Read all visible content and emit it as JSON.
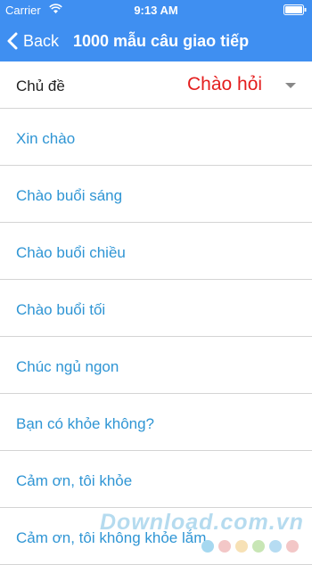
{
  "status_bar": {
    "carrier": "Carrier",
    "time": "9:13 AM",
    "wifi_icon": "wifi-icon",
    "battery_icon": "battery-icon"
  },
  "nav": {
    "back_label": "Back",
    "back_icon": "chevron-left-icon",
    "title": "1000 mẫu câu giao tiếp"
  },
  "topic": {
    "label": "Chủ đề",
    "value": "Chào hỏi",
    "dropdown_icon": "dropdown-arrow-icon"
  },
  "phrases": [
    "Xin chào",
    "Chào buổi sáng",
    "Chào buổi chiều",
    "Chào buổi tối",
    "Chúc ngủ ngon",
    "Bạn có khỏe không?",
    "Cảm ơn, tôi khỏe",
    "Cảm ơn, tôi không khỏe lắm."
  ],
  "watermark": {
    "text": "Download.com.vn",
    "dot_colors": [
      "#a6d8f0",
      "#f3c7c7",
      "#f7e1b5",
      "#c8e6b5",
      "#b6dcf2",
      "#f3c7c7"
    ]
  },
  "colors": {
    "header": "#3f8ff1",
    "accent_value": "#e41e1e",
    "list_text": "#2f95d4"
  }
}
